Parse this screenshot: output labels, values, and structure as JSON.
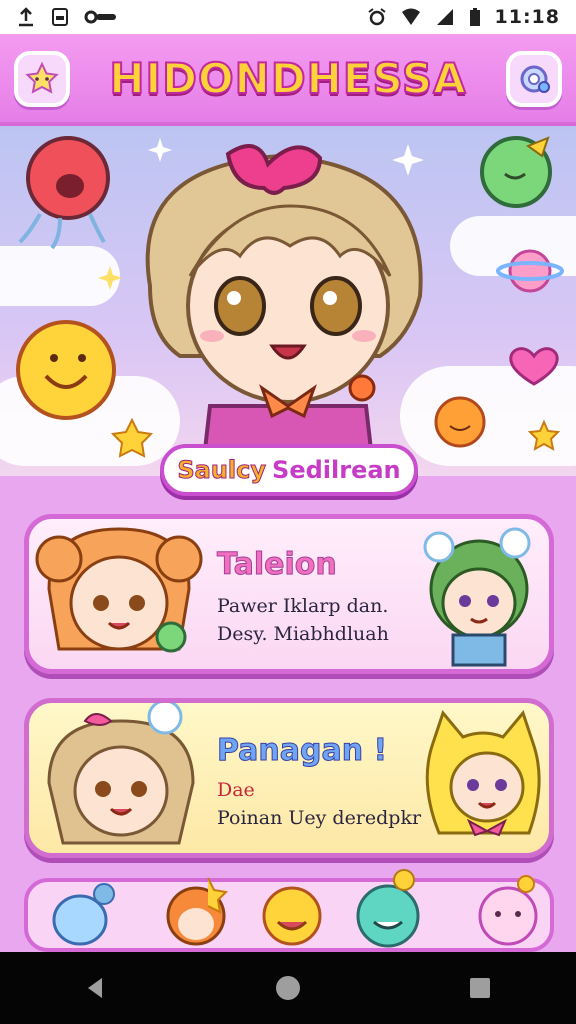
{
  "status_bar": {
    "time": "11:18"
  },
  "header": {
    "title": "HIDONDHESSA"
  },
  "hero": {
    "name_part_a": "Saulcy",
    "name_part_b": "Sedilrean"
  },
  "cards": [
    {
      "title": "Taleion",
      "line1": "Pawer Iklarp dan.",
      "line2": "Desy. Miabhdluah"
    },
    {
      "title": "Panagan !",
      "line1": "Dae",
      "line2": "Poinan Uey deredpkr"
    }
  ],
  "icons": [
    "back-icon",
    "home-icon",
    "recents-icon",
    "star-menu-icon",
    "settings-icon"
  ],
  "colors": {
    "accent": "#d569d6",
    "title": "#ffd23a",
    "status_bg": "#ffffff"
  }
}
